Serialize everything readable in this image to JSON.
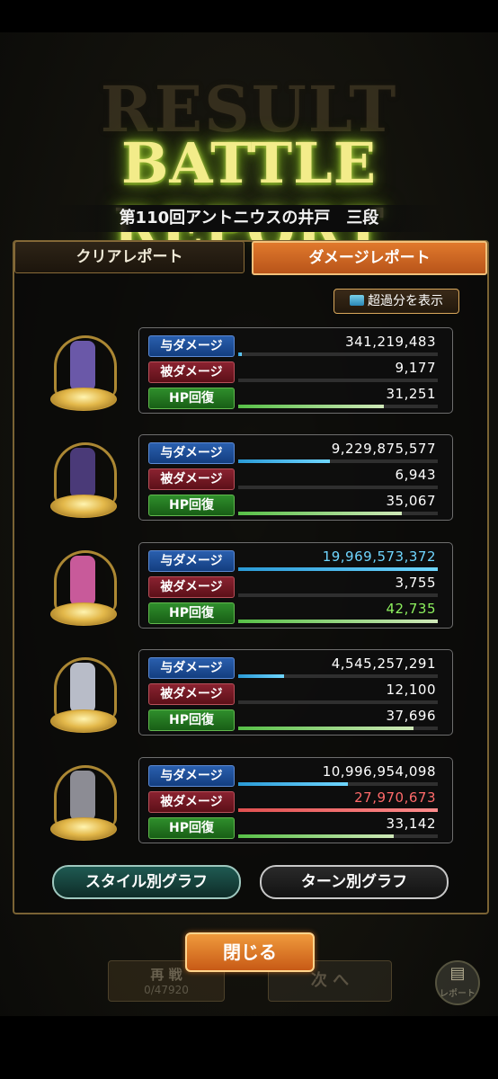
{
  "background_text": {
    "result": "RESULT",
    "retry_label": "再 戦",
    "retry_stamina": "0/47920",
    "next_label": "次 へ",
    "report_icon_label": "レポート"
  },
  "header": {
    "title": "BATTLE REPORT",
    "stage": "第110回アントニウスの井戸　三段"
  },
  "tabs": [
    {
      "label": "クリアレポート",
      "active": false
    },
    {
      "label": "ダメージレポート",
      "active": true
    }
  ],
  "excess_button": {
    "label": "超過分を表示"
  },
  "stat_labels": {
    "dealt": "与ダメージ",
    "taken": "被ダメージ",
    "hp": "HP回復"
  },
  "characters": [
    {
      "dealt": "341,219,483",
      "dealt_fill": 0.02,
      "taken": "9,177",
      "taken_fill": 0.0,
      "hp": "31,251",
      "hp_fill": 0.73,
      "highlight": "",
      "sprite_color": "#6a58a8"
    },
    {
      "dealt": "9,229,875,577",
      "dealt_fill": 0.46,
      "taken": "6,943",
      "taken_fill": 0.0,
      "hp": "35,067",
      "hp_fill": 0.82,
      "highlight": "",
      "sprite_color": "#4a3a78"
    },
    {
      "dealt": "19,969,573,372",
      "dealt_fill": 1.0,
      "taken": "3,755",
      "taken_fill": 0.0,
      "hp": "42,735",
      "hp_fill": 1.0,
      "highlight": "dealt,hp",
      "sprite_color": "#c85a9a"
    },
    {
      "dealt": "4,545,257,291",
      "dealt_fill": 0.23,
      "taken": "12,100",
      "taken_fill": 0.0,
      "hp": "37,696",
      "hp_fill": 0.88,
      "highlight": "",
      "sprite_color": "#b8bcc8"
    },
    {
      "dealt": "10,996,954,098",
      "dealt_fill": 0.55,
      "taken": "27,970,673",
      "taken_fill": 1.0,
      "hp": "33,142",
      "hp_fill": 0.78,
      "highlight": "taken",
      "sprite_color": "#8c8c94"
    }
  ],
  "graph_buttons": {
    "style": "スタイル別グラフ",
    "turn": "ターン別グラフ"
  },
  "close_button": {
    "label": "閉じる"
  },
  "colors": {
    "accent_orange": "#e0792c",
    "dealt_blue": "#6fd6ff",
    "taken_red": "#ff6a6a",
    "hp_green": "#8df05e",
    "title_glow": "#b7d84a"
  }
}
